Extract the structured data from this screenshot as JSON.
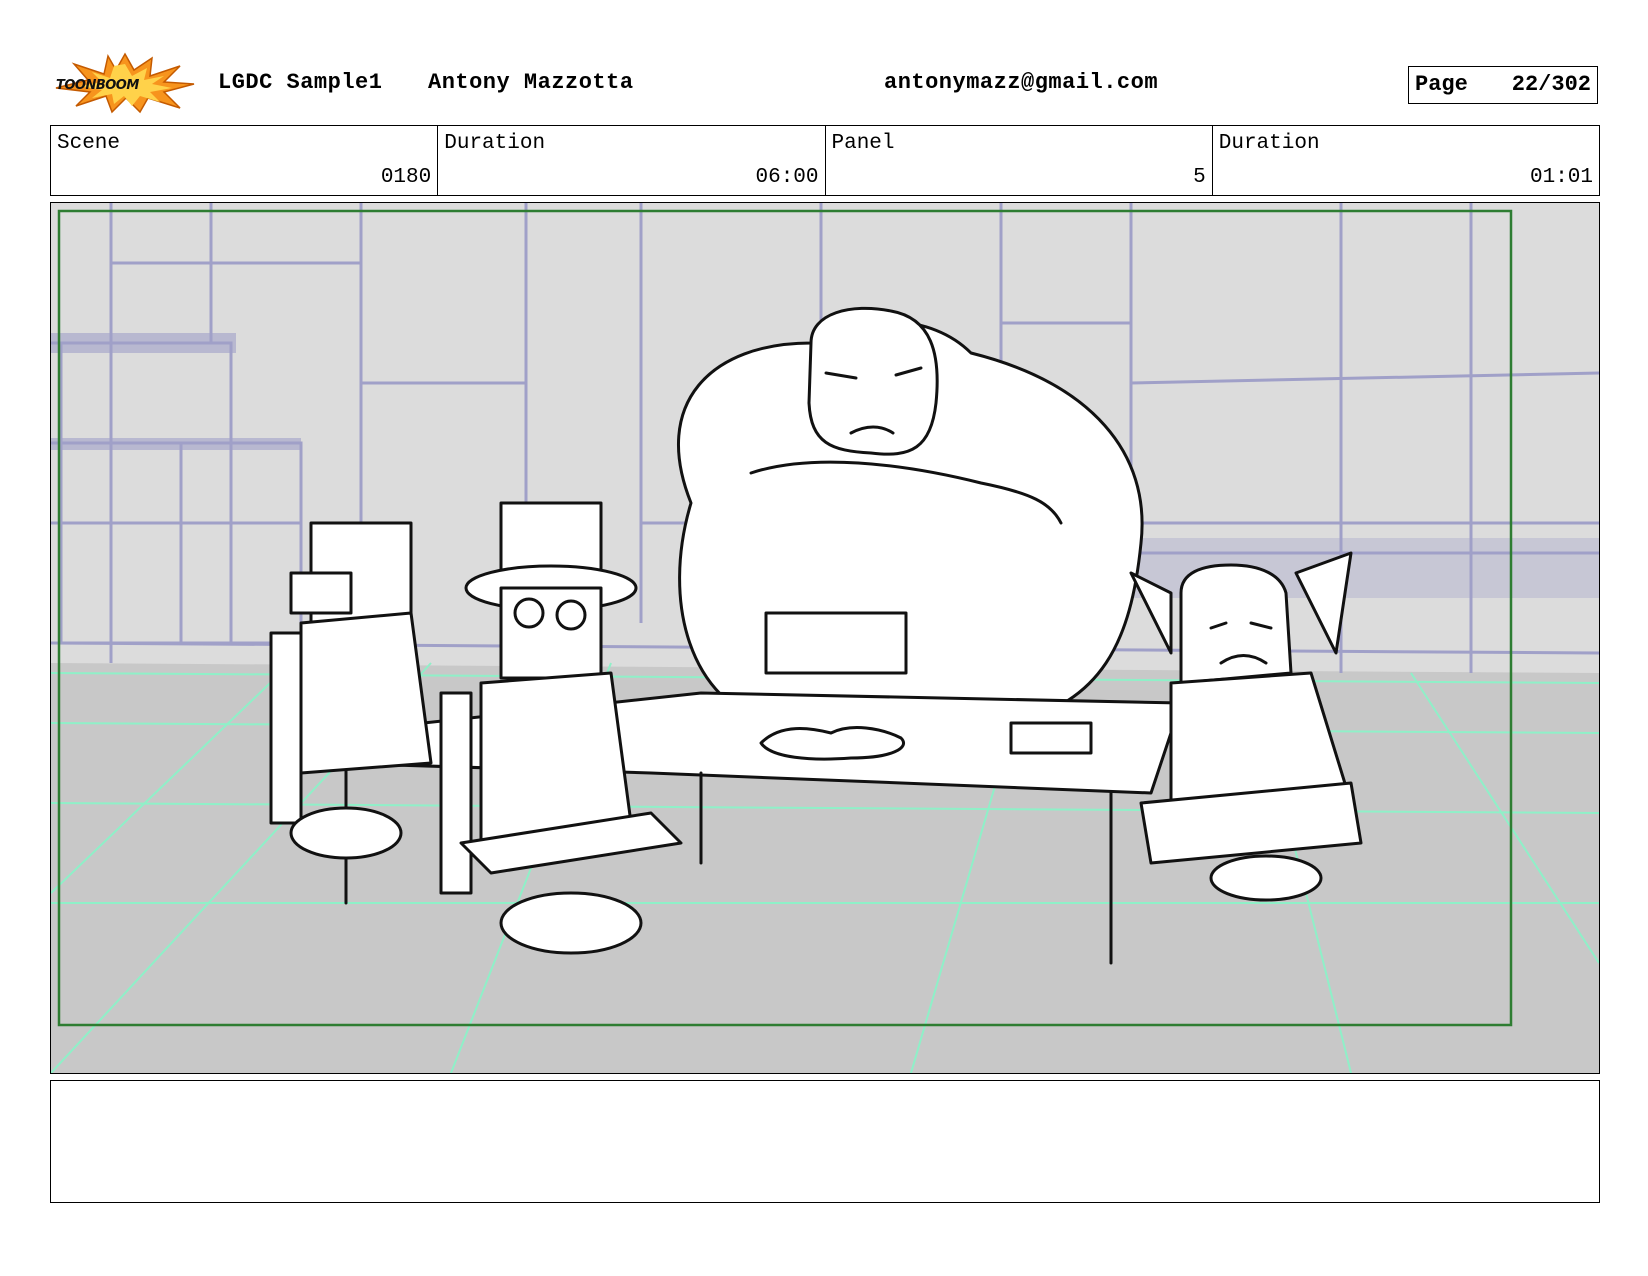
{
  "header": {
    "logo_text": "TOONBOOM",
    "project": "LGDC Sample1",
    "author": "Antony Mazzotta",
    "email": "antonymazz@gmail.com",
    "page_label": "Page",
    "page_value": "22/302"
  },
  "info": {
    "scene_label": "Scene",
    "scene_value": "0180",
    "duration_label": "Duration",
    "duration_value": "06:00",
    "panel_label": "Panel",
    "panel_value": "5",
    "panel_duration_label": "Duration",
    "panel_duration_value": "01:01"
  },
  "notes": {
    "text": ""
  },
  "colors": {
    "frame_border": "#2e7d32",
    "background_lines": "#a0a0c8",
    "floor_grid": "#8ff0c8",
    "sky": "#dcdcdc",
    "floor": "#c6c6c6"
  }
}
